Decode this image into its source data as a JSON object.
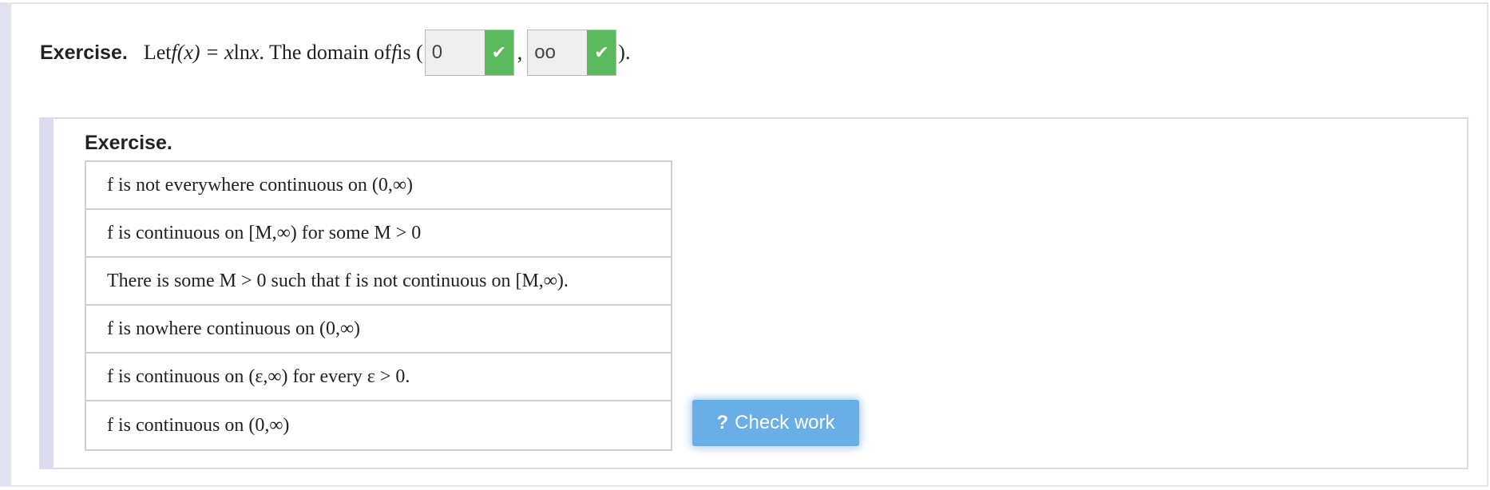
{
  "exercise": {
    "label": "Exercise.",
    "prefix": "Let ",
    "func_name": "f",
    "paren_open_x": "(x) = x ",
    "ln": "ln",
    "var_x": " x",
    "domain_text": ". The domain of ",
    "func_name2": "f",
    "is_text": " is (",
    "answer1": "0",
    "comma": ",",
    "answer2": "oo",
    "suffix": ").",
    "check_color": "#5cb85c"
  },
  "inner": {
    "title": "Exercise.",
    "choices": [
      "f is not everywhere continuous on (0,∞)",
      "f is continuous on [M,∞) for some M > 0",
      "There is some M > 0 such that f is not continuous on [M,∞).",
      "f is nowhere continuous on (0,∞)",
      "f is continuous on (ε,∞) for every ε > 0.",
      "f is continuous on (0,∞)"
    ],
    "check_button_icon": "?",
    "check_button_label": "Check work",
    "button_color": "#6aaee8"
  }
}
